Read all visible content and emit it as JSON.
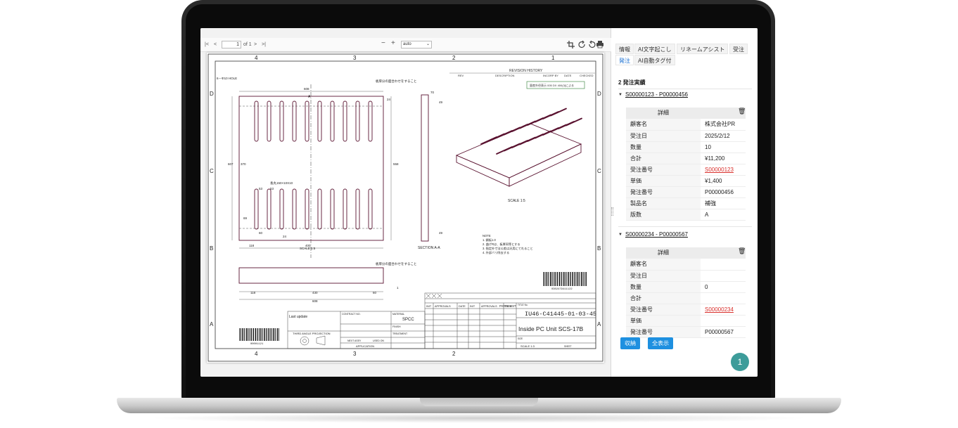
{
  "toolbar": {
    "first_page_icon": "first-page-icon",
    "prev_page_icon": "prev-page-icon",
    "page_value": "1",
    "page_of": "of 1",
    "next_page_icon": "next-page-icon",
    "last_page_icon": "last-page-icon",
    "zoom_out": "−",
    "zoom_in": "+",
    "zoom_value": "auto",
    "icons": [
      "crop-icon",
      "rotate-right-icon",
      "rotate-left-icon",
      "print-icon"
    ]
  },
  "drawing": {
    "col_labels": [
      "4",
      "3",
      "2",
      "1"
    ],
    "row_labels": [
      "D",
      "C",
      "B",
      "A"
    ],
    "revision_history": "REVISION HISTORY",
    "rev_headers": [
      "REV",
      "DESCRIPTION",
      "INCORP BY",
      "DATE",
      "CHECKED"
    ],
    "stamp_note": "量産外径表示 005 DX 400(3)による",
    "hole_note": "6－Φ10 HOLE",
    "edge_note_top": "板厚分の面合わせをすること",
    "edge_note_bottom": "板厚分の面合わせをすること",
    "slot_note": "長丸150×10X10",
    "dims": {
      "d608_top": "608",
      "d24_top": "24",
      "d607": "607",
      "d370": "370",
      "d558": "558",
      "d53a": "53",
      "d53b": "53",
      "d69": "69",
      "d60": "60",
      "d24_mid": "24",
      "d118": "118",
      "d430_bottom": "430",
      "d400": "400",
      "d70": "70",
      "d49a": "49",
      "d49b": "49",
      "d118_b": "118",
      "d430_b": "430",
      "d60_b": "60",
      "d608_b": "608",
      "d1": "1"
    },
    "section_label": "SECTION A-A",
    "scale_label_iso": "SCALE 1:5",
    "scale_label_plan": "SCALE 1:5",
    "a_marker": "A",
    "notes_title": "NOTE",
    "notes": [
      "1. 鋼板1.0",
      "2. 曲げRは、板厚同等とする",
      "3. 指定外寸法公差は汎用にてれること",
      "4. 外部バリ除去する"
    ],
    "barcode_right_text": "0302479411122",
    "barcode_left_text": "00001121",
    "parts_list": "PARTS LIST",
    "part_headers": [
      "PART NO.\nDESCRIPTION",
      "DESCRIPTION"
    ],
    "approvals": [
      "INIT",
      "APPROVALS",
      "DATE",
      "INIT",
      "APPROVALS",
      "DATE"
    ],
    "title_label": "TITLE No.",
    "drawing_number": "IU46-C41445-01-03-45",
    "drawing_title": "Inside PC Unit SCS-17B",
    "size_label": "SIZE",
    "size_value": "A3",
    "scale_footer": "SCALE  1:3",
    "sheet_label": "SHEET",
    "last_update": "Last update",
    "third_angle": "THIRD ANGLE PROJECTION",
    "contract_no": "CONTRACT NO.",
    "material_label": "MATERIAL",
    "material_value": "SPCC",
    "finish_label": "FINISH",
    "treatment_label": "TREATMENT",
    "application": "APPLICATION",
    "next_assy": "NEXT ASSY",
    "used_on": "USED ON"
  },
  "panel": {
    "tabs": [
      "情報",
      "AI文字起こし",
      "リネームアシスト",
      "受注",
      "発注",
      "AI自動タグ付"
    ],
    "heading": "2 発注実績",
    "orders": [
      {
        "title": "S00000123 - P00000456",
        "detail_label": "詳細",
        "rows": [
          {
            "k": "顧客名",
            "v": "株式会社PR"
          },
          {
            "k": "受注日",
            "v": "2025/2/12"
          },
          {
            "k": "数量",
            "v": "10"
          },
          {
            "k": "合計",
            "v": "¥11,200"
          },
          {
            "k": "受注番号",
            "v": "S00000123"
          },
          {
            "k": "単価",
            "v": "¥1,400"
          },
          {
            "k": "発注番号",
            "v": "P00000456"
          },
          {
            "k": "製品名",
            "v": "補強"
          },
          {
            "k": "版数",
            "v": "A"
          }
        ]
      },
      {
        "title": "S00000234 - P00000567",
        "detail_label": "詳細",
        "rows": [
          {
            "k": "顧客名",
            "v": ""
          },
          {
            "k": "受注日",
            "v": ""
          },
          {
            "k": "数量",
            "v": "0"
          },
          {
            "k": "合計",
            "v": ""
          },
          {
            "k": "受注番号",
            "v": "S00000234"
          },
          {
            "k": "単価",
            "v": ""
          },
          {
            "k": "発注番号",
            "v": "P00000567"
          }
        ]
      }
    ],
    "collapse_button": "収納",
    "show_all_button": "全表示",
    "badge": "1"
  }
}
